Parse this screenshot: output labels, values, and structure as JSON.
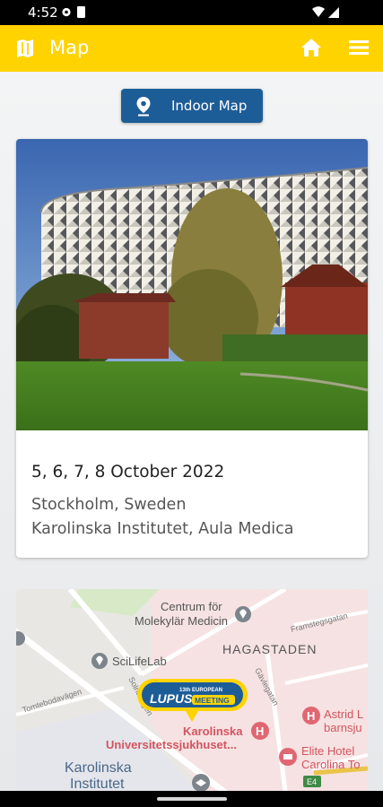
{
  "status": {
    "time": "4:52"
  },
  "app": {
    "title": "Map"
  },
  "indoor_button": {
    "label": "Indoor Map"
  },
  "event": {
    "date": "5, 6, 7, 8 October 2022",
    "city": "Stockholm, Sweden",
    "venue": "Karolinska Institutet, Aula Medica"
  },
  "map": {
    "labels": {
      "centrum": "Centrum för",
      "molekylar": "Molekylär Medicin",
      "hagastaden": "HAGASTADEN",
      "scilifelab": "SciLifeLab",
      "framstegsgatan": "Framstegsgatan",
      "gavlegatan": "Gävlegatan",
      "tomtebodavagen": "Tomtebodavägen",
      "solnavagen": "Solnavägen",
      "astrid": "Astrid L",
      "barnsjukhus": "barnsju",
      "karolinska_univ1": "Karolinska",
      "karolinska_univ2": "Universitetssjukhuset...",
      "elite1": "Elite Hotel",
      "elite2": "Carolina To",
      "ki1": "Karolinska",
      "ki2": "Institutet",
      "road": "E4"
    },
    "marker": {
      "top": "13th EUROPEAN",
      "lupus": "LUPUS",
      "meeting": "MEETING"
    }
  }
}
